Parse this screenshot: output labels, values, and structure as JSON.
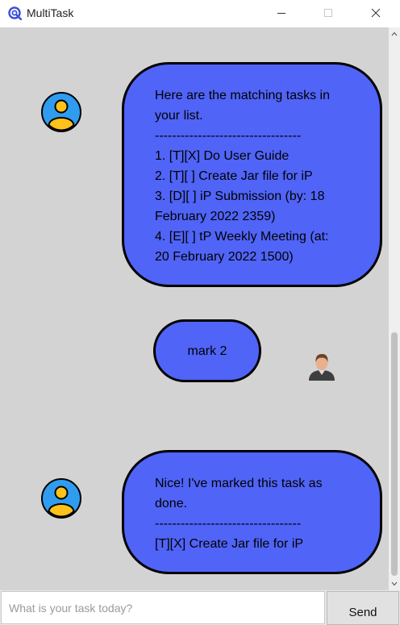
{
  "window": {
    "title": "MultiTask",
    "icon": "app-logo-icon",
    "controls": [
      "minimize-icon",
      "maximize-icon",
      "close-icon"
    ]
  },
  "messages": [
    {
      "sender": "bot",
      "avatar": "bot-avatar-icon",
      "lines": [
        "Here are the matching tasks in",
        "your list.",
        "----------------------------------",
        "1. [T][X] Do User Guide",
        "2. [T][ ] Create Jar file for iP",
        "3. [D][ ] iP Submission (by: 18",
        "February 2022 2359)",
        "4. [E][ ] tP Weekly Meeting (at:",
        "20 February 2022 1500)"
      ]
    },
    {
      "sender": "user",
      "avatar": "user-avatar-icon",
      "text": "mark 2"
    },
    {
      "sender": "bot",
      "avatar": "bot-avatar-icon",
      "lines": [
        "Nice! I've marked this task as",
        "done.",
        "----------------------------------",
        "[T][X] Create Jar file for iP"
      ]
    }
  ],
  "input": {
    "placeholder": "What is your task today?",
    "value": ""
  },
  "send_button": {
    "label": "Send"
  },
  "colors": {
    "bubble": "#5064f7",
    "chat_background": "#d3d3d3",
    "bot_avatar_ring": "#2f9cf0",
    "bot_avatar_figure": "#ffc21a"
  }
}
